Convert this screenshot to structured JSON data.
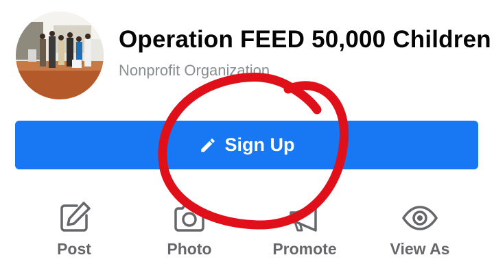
{
  "page": {
    "name": "Operation FEED 50,000 Children",
    "category": "Nonprofit Organization"
  },
  "cta_button": {
    "label": "Sign Up",
    "icon": "pencil-icon",
    "color": "#1877f2"
  },
  "actions": [
    {
      "label": "Post",
      "icon": "edit-icon"
    },
    {
      "label": "Photo",
      "icon": "camera-icon"
    },
    {
      "label": "Promote",
      "icon": "megaphone-icon"
    },
    {
      "label": "View As",
      "icon": "eye-icon"
    }
  ],
  "annotation": {
    "shape": "hand-drawn circle",
    "color": "#e0101a"
  },
  "colors": {
    "text": "#050505",
    "secondary": "#65676b",
    "muted": "#8a8d91"
  }
}
